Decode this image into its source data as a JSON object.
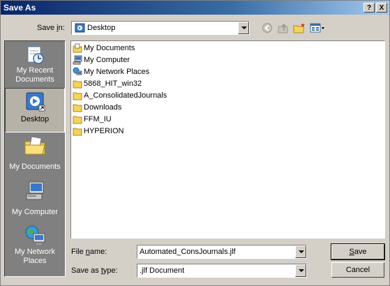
{
  "window": {
    "title": "Save As",
    "help_button": "?",
    "close_button": "X"
  },
  "header": {
    "save_in_label_pre": "Save ",
    "save_in_label_key": "i",
    "save_in_label_post": "n:",
    "save_in_value": "Desktop"
  },
  "places": [
    {
      "label": "My Recent Documents",
      "icon": "recent-documents-icon"
    },
    {
      "label": "Desktop",
      "icon": "desktop-icon",
      "selected": true
    },
    {
      "label": "My Documents",
      "icon": "my-documents-icon"
    },
    {
      "label": "My Computer",
      "icon": "my-computer-icon"
    },
    {
      "label": "My Network Places",
      "icon": "network-places-icon"
    }
  ],
  "files": [
    {
      "name": "My Documents",
      "icon": "my-documents-icon"
    },
    {
      "name": "My Computer",
      "icon": "my-computer-icon"
    },
    {
      "name": "My Network Places",
      "icon": "network-places-icon"
    },
    {
      "name": "5868_HIT_win32",
      "icon": "folder-icon"
    },
    {
      "name": "A_ConsolidatedJournals",
      "icon": "folder-icon"
    },
    {
      "name": "Downloads",
      "icon": "folder-icon"
    },
    {
      "name": "FFM_IU",
      "icon": "folder-icon"
    },
    {
      "name": "HYPERION",
      "icon": "folder-icon"
    }
  ],
  "footer": {
    "file_name_label_pre": "File ",
    "file_name_label_key": "n",
    "file_name_label_post": "ame:",
    "file_name_value": "Automated_ConsJournals.jlf",
    "save_type_label_pre": "Save as ",
    "save_type_label_key": "t",
    "save_type_label_post": "ype:",
    "save_type_value": ".jlf Document",
    "save_button_key": "S",
    "save_button_rest": "ave",
    "cancel_button": "Cancel"
  },
  "colors": {
    "titlebar_start": "#0a246a",
    "titlebar_end": "#a6caf0",
    "dialog_bg": "#d4d0c8",
    "places_bg": "#808080",
    "folder_yellow": "#f5d35c"
  }
}
